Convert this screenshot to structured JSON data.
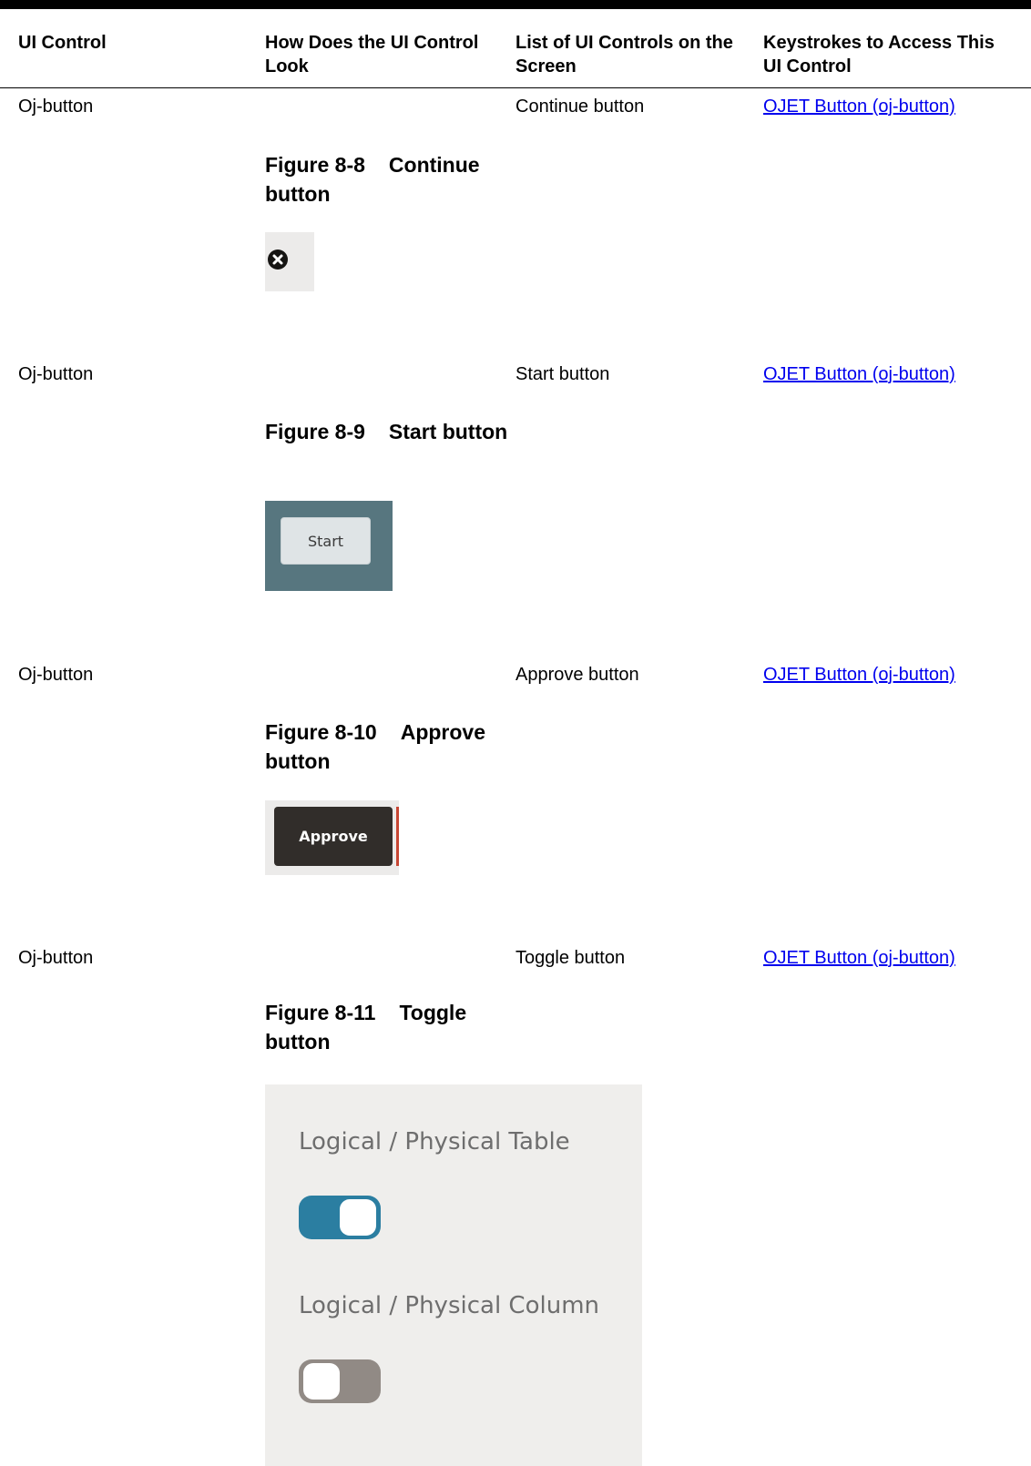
{
  "table": {
    "headers": [
      "UI Control",
      "How Does the UI Control Look",
      "List of UI Controls on the Screen",
      "Keystrokes to Access This UI Control"
    ],
    "rows": [
      {
        "control": "Oj-button",
        "figure_number": "Figure 8-8",
        "figure_caption": "Continue button",
        "list_item": "Continue button",
        "keystroke_link": "OJET Button (oj-button)",
        "icon": "close-circle-icon"
      },
      {
        "control": "Oj-button",
        "figure_number": "Figure 8-9",
        "figure_caption": "Start button",
        "list_item": "Start button",
        "keystroke_link": "OJET Button (oj-button)",
        "button_text": "Start"
      },
      {
        "control": "Oj-button",
        "figure_number": "Figure 8-10",
        "figure_caption": "Approve button",
        "list_item": "Approve button",
        "keystroke_link": "OJET Button (oj-button)",
        "button_text": "Approve"
      },
      {
        "control": "Oj-button",
        "figure_number": "Figure 8-11",
        "figure_caption": "Toggle button",
        "list_item": "Toggle button",
        "keystroke_link": "OJET Button (oj-button)",
        "toggles": [
          {
            "label": "Logical / Physical Table",
            "state": "on"
          },
          {
            "label": "Logical / Physical Column",
            "state": "off"
          }
        ]
      }
    ]
  },
  "colors": {
    "link": "#0000ee",
    "start_panel": "#57767f",
    "approve_button": "#312d2a",
    "toggle_on": "#2b7ea1",
    "toggle_off": "#918a85"
  }
}
